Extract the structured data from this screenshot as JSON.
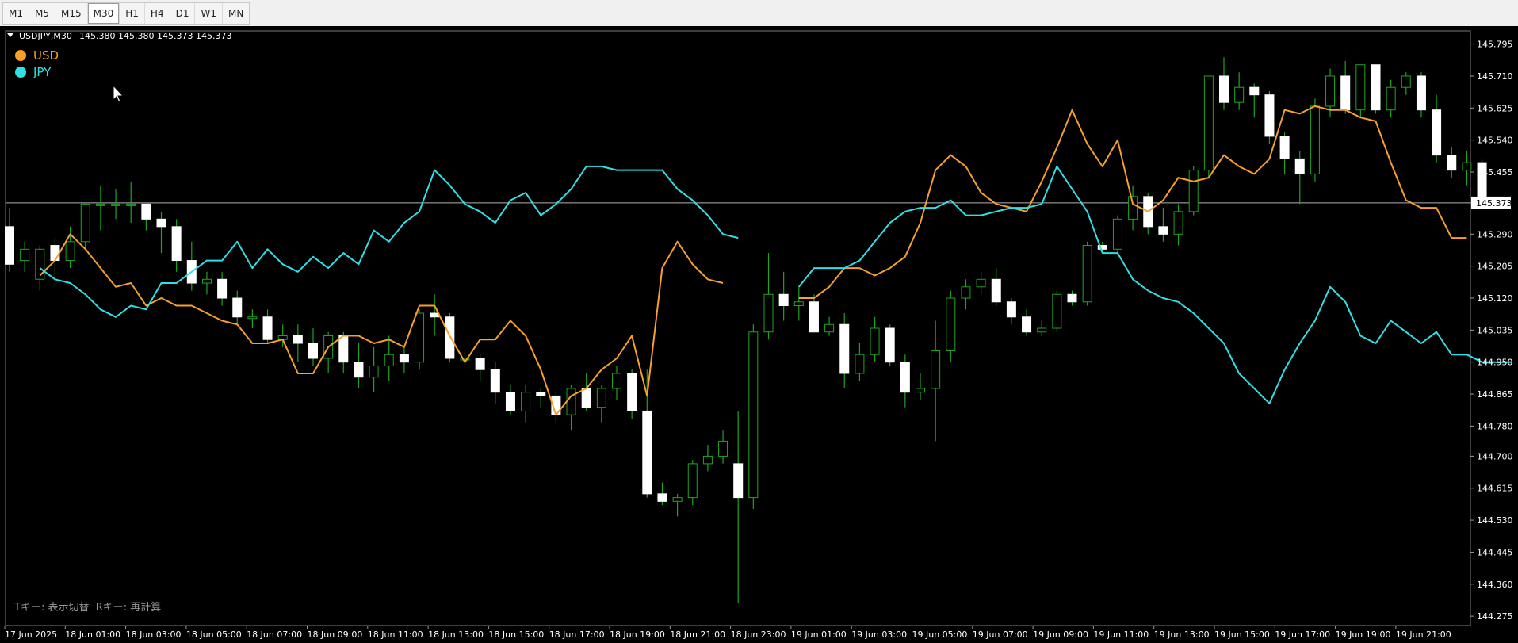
{
  "toolbar": {
    "timeframes": [
      "M1",
      "M5",
      "M15",
      "M30",
      "H1",
      "H4",
      "D1",
      "W1",
      "MN"
    ],
    "active": "M30"
  },
  "chart": {
    "symbol_header": "USDJPY,M30",
    "ohlc_header": "145.380 145.380 145.373 145.373",
    "current_price_label": "145.373",
    "footer_hint": "Tキー: 表示切替  Rキー: 再計算",
    "legend": [
      {
        "name": "USD",
        "color": "#f7a02a"
      },
      {
        "name": "JPY",
        "color": "#2fe0e6"
      }
    ],
    "colors": {
      "background": "#000000",
      "candle_wick": "#1ea51e",
      "candle_bull_border": "#1ea51e",
      "candle_bear_fill": "#ffffff",
      "price_line": "#b4b4b4",
      "axis_text": "#ffffff"
    }
  },
  "chart_data": {
    "type": "candlestick",
    "x_tick_labels": [
      "17 Jun 2025",
      "18 Jun 01:00",
      "18 Jun 03:00",
      "18 Jun 05:00",
      "18 Jun 07:00",
      "18 Jun 09:00",
      "18 Jun 11:00",
      "18 Jun 13:00",
      "18 Jun 15:00",
      "18 Jun 17:00",
      "18 Jun 19:00",
      "18 Jun 21:00",
      "18 Jun 23:00",
      "19 Jun 01:00",
      "19 Jun 03:00",
      "19 Jun 05:00",
      "19 Jun 07:00",
      "19 Jun 09:00",
      "19 Jun 11:00",
      "19 Jun 13:00",
      "19 Jun 15:00",
      "19 Jun 17:00",
      "19 Jun 19:00",
      "19 Jun 21:00"
    ],
    "y_tick_labels": [
      "145.795",
      "145.710",
      "145.625",
      "145.540",
      "145.455",
      "145.373",
      "145.290",
      "145.205",
      "145.120",
      "145.035",
      "144.950",
      "144.865",
      "144.780",
      "144.700",
      "144.615",
      "144.530",
      "144.445",
      "144.360",
      "144.275"
    ],
    "ylim": [
      144.25,
      145.83
    ],
    "current_price": 145.373,
    "candles_ohlc": [
      [
        145.31,
        145.36,
        145.19,
        145.21
      ],
      [
        145.22,
        145.27,
        145.19,
        145.25
      ],
      [
        145.17,
        145.26,
        145.14,
        145.25
      ],
      [
        145.26,
        145.28,
        145.15,
        145.22
      ],
      [
        145.22,
        145.31,
        145.2,
        145.27
      ],
      [
        145.27,
        145.37,
        145.25,
        145.37
      ],
      [
        145.37,
        145.42,
        145.3,
        145.37
      ],
      [
        145.37,
        145.41,
        145.33,
        145.37
      ],
      [
        145.37,
        145.43,
        145.32,
        145.37
      ],
      [
        145.37,
        145.37,
        145.3,
        145.33
      ],
      [
        145.33,
        145.35,
        145.24,
        145.31
      ],
      [
        145.31,
        145.33,
        145.19,
        145.22
      ],
      [
        145.22,
        145.27,
        145.14,
        145.16
      ],
      [
        145.16,
        145.19,
        145.13,
        145.17
      ],
      [
        145.17,
        145.19,
        145.1,
        145.12
      ],
      [
        145.12,
        145.14,
        145.05,
        145.07
      ],
      [
        145.07,
        145.09,
        145.04,
        145.07
      ],
      [
        145.07,
        145.09,
        145.0,
        145.01
      ],
      [
        145.01,
        145.05,
        144.99,
        145.02
      ],
      [
        145.02,
        145.05,
        144.95,
        145.0
      ],
      [
        145.0,
        145.04,
        144.94,
        144.96
      ],
      [
        144.96,
        145.03,
        144.92,
        145.02
      ],
      [
        145.02,
        145.03,
        144.92,
        144.95
      ],
      [
        144.95,
        145.0,
        144.88,
        144.91
      ],
      [
        144.91,
        144.99,
        144.87,
        144.94
      ],
      [
        144.94,
        145.02,
        144.9,
        144.97
      ],
      [
        144.97,
        144.99,
        144.92,
        144.95
      ],
      [
        144.95,
        145.09,
        144.93,
        145.08
      ],
      [
        145.08,
        145.13,
        145.02,
        145.07
      ],
      [
        145.07,
        145.08,
        144.95,
        144.96
      ],
      [
        144.96,
        144.98,
        144.94,
        144.96
      ],
      [
        144.96,
        144.97,
        144.9,
        144.93
      ],
      [
        144.93,
        144.95,
        144.84,
        144.87
      ],
      [
        144.87,
        144.89,
        144.81,
        144.82
      ],
      [
        144.82,
        144.89,
        144.79,
        144.87
      ],
      [
        144.87,
        144.88,
        144.83,
        144.86
      ],
      [
        144.86,
        144.87,
        144.79,
        144.81
      ],
      [
        144.81,
        144.89,
        144.77,
        144.88
      ],
      [
        144.88,
        144.92,
        144.82,
        144.83
      ],
      [
        144.83,
        144.89,
        144.79,
        144.88
      ],
      [
        144.88,
        144.94,
        144.85,
        144.92
      ],
      [
        144.92,
        144.93,
        144.8,
        144.82
      ],
      [
        144.82,
        144.93,
        144.59,
        144.6
      ],
      [
        144.6,
        144.63,
        144.57,
        144.58
      ],
      [
        144.58,
        144.6,
        144.54,
        144.59
      ],
      [
        144.59,
        144.69,
        144.57,
        144.68
      ],
      [
        144.68,
        144.73,
        144.66,
        144.7
      ],
      [
        144.7,
        144.77,
        144.68,
        144.74
      ],
      [
        144.68,
        144.82,
        144.31,
        144.59
      ],
      [
        144.59,
        145.05,
        144.56,
        145.03
      ],
      [
        145.03,
        145.24,
        145.01,
        145.13
      ],
      [
        145.13,
        145.19,
        145.06,
        145.1
      ],
      [
        145.1,
        145.15,
        145.06,
        145.11
      ],
      [
        145.11,
        145.13,
        145.03,
        145.03
      ],
      [
        145.03,
        145.07,
        145.02,
        145.05
      ],
      [
        145.05,
        145.08,
        144.88,
        144.92
      ],
      [
        144.92,
        145.0,
        144.9,
        144.97
      ],
      [
        144.97,
        145.07,
        144.95,
        145.04
      ],
      [
        145.04,
        145.05,
        144.94,
        144.95
      ],
      [
        144.95,
        144.97,
        144.83,
        144.87
      ],
      [
        144.87,
        144.92,
        144.85,
        144.88
      ],
      [
        144.88,
        145.06,
        144.74,
        144.98
      ],
      [
        144.98,
        145.14,
        144.95,
        145.12
      ],
      [
        145.12,
        145.17,
        145.09,
        145.15
      ],
      [
        145.15,
        145.19,
        145.13,
        145.17
      ],
      [
        145.17,
        145.2,
        145.1,
        145.11
      ],
      [
        145.11,
        145.12,
        145.05,
        145.07
      ],
      [
        145.07,
        145.09,
        145.02,
        145.03
      ],
      [
        145.03,
        145.06,
        145.02,
        145.04
      ],
      [
        145.04,
        145.14,
        145.03,
        145.13
      ],
      [
        145.13,
        145.14,
        145.1,
        145.11
      ],
      [
        145.11,
        145.27,
        145.1,
        145.26
      ],
      [
        145.26,
        145.27,
        145.24,
        145.25
      ],
      [
        145.25,
        145.34,
        145.24,
        145.33
      ],
      [
        145.33,
        145.42,
        145.3,
        145.39
      ],
      [
        145.39,
        145.4,
        145.29,
        145.31
      ],
      [
        145.31,
        145.36,
        145.27,
        145.29
      ],
      [
        145.29,
        145.37,
        145.26,
        145.35
      ],
      [
        145.35,
        145.47,
        145.34,
        145.46
      ],
      [
        145.46,
        145.71,
        145.44,
        145.71
      ],
      [
        145.71,
        145.76,
        145.62,
        145.64
      ],
      [
        145.64,
        145.72,
        145.62,
        145.68
      ],
      [
        145.68,
        145.69,
        145.6,
        145.66
      ],
      [
        145.66,
        145.67,
        145.53,
        145.55
      ],
      [
        145.55,
        145.56,
        145.45,
        145.49
      ],
      [
        145.49,
        145.51,
        145.37,
        145.45
      ],
      [
        145.45,
        145.65,
        145.43,
        145.63
      ],
      [
        145.63,
        145.73,
        145.6,
        145.71
      ],
      [
        145.71,
        145.75,
        145.61,
        145.62
      ],
      [
        145.62,
        145.74,
        145.6,
        145.74
      ],
      [
        145.74,
        145.74,
        145.61,
        145.62
      ],
      [
        145.62,
        145.7,
        145.6,
        145.68
      ],
      [
        145.68,
        145.72,
        145.66,
        145.71
      ],
      [
        145.71,
        145.72,
        145.6,
        145.62
      ],
      [
        145.62,
        145.66,
        145.48,
        145.5
      ],
      [
        145.5,
        145.52,
        145.44,
        145.46
      ],
      [
        145.46,
        145.51,
        145.42,
        145.48
      ],
      [
        145.48,
        145.49,
        145.37,
        145.38
      ],
      [
        145.38,
        145.38,
        145.37,
        145.373
      ]
    ],
    "series": [
      {
        "name": "USD",
        "color": "#f7a02a",
        "segments": [
          [
            [
              145.18,
              145.22,
              145.29,
              145.25,
              145.2,
              145.15,
              145.16,
              145.1,
              145.12,
              145.1,
              145.1,
              145.08,
              145.06,
              145.05,
              145.0,
              145.0,
              145.01,
              144.92,
              144.92,
              144.99,
              145.02,
              145.02,
              145.0,
              145.01,
              144.99,
              145.1,
              145.1,
              145.02,
              144.95,
              145.01,
              145.01,
              145.06,
              145.02,
              144.93,
              144.81,
              144.86,
              144.88,
              144.93,
              144.96,
              145.02,
              144.86,
              145.2,
              145.27,
              145.21,
              145.17,
              145.16
            ]
          ],
          [
            [
              145.12,
              145.12,
              145.15,
              145.2,
              145.2,
              145.18,
              145.2,
              145.23,
              145.32,
              145.46,
              145.5,
              145.47,
              145.4,
              145.37,
              145.36,
              145.35,
              145.43,
              145.52,
              145.62,
              145.53,
              145.47,
              145.54,
              145.37,
              145.35,
              145.38,
              145.44,
              145.43,
              145.44,
              145.5,
              145.47,
              145.45,
              145.49,
              145.62,
              145.61,
              145.63,
              145.62,
              145.62,
              145.6,
              145.59,
              145.48,
              145.38,
              145.36,
              145.36,
              145.28,
              145.28
            ]
          ]
        ]
      },
      {
        "name": "JPY",
        "color": "#2fe0e6",
        "segments": [
          [
            [
              145.2,
              145.17,
              145.16,
              145.13,
              145.09,
              145.07,
              145.1,
              145.09,
              145.16,
              145.16,
              145.19,
              145.22,
              145.22,
              145.27,
              145.2,
              145.25,
              145.21,
              145.19,
              145.23,
              145.2,
              145.24,
              145.21,
              145.3,
              145.27,
              145.32,
              145.35,
              145.46,
              145.42,
              145.37,
              145.35,
              145.32,
              145.38,
              145.4,
              145.34,
              145.37,
              145.41,
              145.47,
              145.47,
              145.46,
              145.46,
              145.46,
              145.46,
              145.41,
              145.38,
              145.34,
              145.29,
              145.28
            ]
          ],
          [
            [
              145.15,
              145.2,
              145.2,
              145.2,
              145.22,
              145.27,
              145.32,
              145.35,
              145.36,
              145.36,
              145.38,
              145.34,
              145.34,
              145.35,
              145.36,
              145.36,
              145.37,
              145.47,
              145.41,
              145.35,
              145.24,
              145.24,
              145.17,
              145.14,
              145.12,
              145.11,
              145.08,
              145.04,
              145.0,
              144.92,
              144.88,
              144.84,
              144.93,
              145.0,
              145.06,
              145.15,
              145.11,
              145.02,
              145.0,
              145.06,
              145.03,
              145.0,
              145.03,
              144.97,
              144.97,
              144.95,
              144.95,
              144.95
            ]
          ]
        ]
      }
    ]
  }
}
